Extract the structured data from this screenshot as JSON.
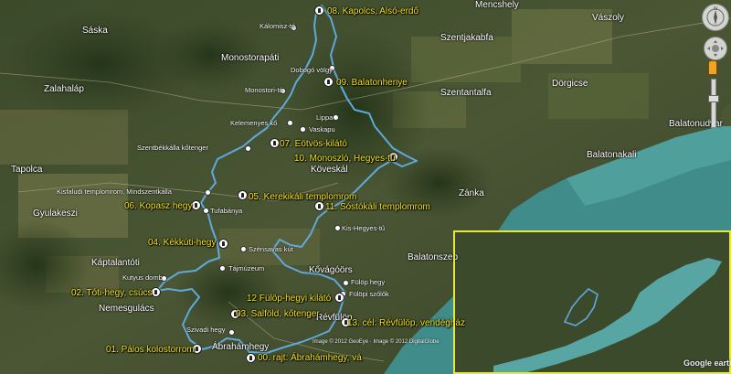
{
  "towns": [
    {
      "id": "saska",
      "text": "Sáska"
    },
    {
      "id": "zalahalap",
      "text": "Zalahaláp"
    },
    {
      "id": "monostorapati",
      "text": "Monostorapáti"
    },
    {
      "id": "tapolca",
      "text": "Tapolca"
    },
    {
      "id": "gyulakeszi",
      "text": "Gyulakeszi"
    },
    {
      "id": "kaptalantoti",
      "text": "Káptalantóti"
    },
    {
      "id": "nemesgulacs",
      "text": "Nemesgulács"
    },
    {
      "id": "kovagoors",
      "text": "Kővágóörs"
    },
    {
      "id": "mencshely",
      "text": "Mencshely"
    },
    {
      "id": "vaszoly",
      "text": "Vászoly"
    },
    {
      "id": "szentjakabfa",
      "text": "Szentjakabfa"
    },
    {
      "id": "dorgicse",
      "text": "Dörgicse"
    },
    {
      "id": "szentantalfa",
      "text": "Szentantalfa"
    },
    {
      "id": "balatonudvari",
      "text": "Balatonudvar"
    },
    {
      "id": "balatonakali",
      "text": "Balatonakali"
    },
    {
      "id": "zanka",
      "text": "Zánka"
    },
    {
      "id": "balatonszep",
      "text": "Balatonszep"
    },
    {
      "id": "koveskal",
      "text": "Köveskál"
    },
    {
      "id": "abrahamhegy",
      "text": "Ábrahámhegy"
    },
    {
      "id": "revfulop",
      "text": "Révfülöp"
    }
  ],
  "pois": [
    {
      "id": "kalomisz-to",
      "text": "Kálomisz-tó"
    },
    {
      "id": "dobogo-volgy",
      "text": "Dobogó völgy"
    },
    {
      "id": "monostori-to",
      "text": "Monostori-tó"
    },
    {
      "id": "lippa",
      "text": "Lippa"
    },
    {
      "id": "vaskapu",
      "text": "Vaskapu"
    },
    {
      "id": "kelemenyes-ko",
      "text": "Kelemenyes kő"
    },
    {
      "id": "szentbekkalla-kotenger",
      "text": "Szentbékkálla kőtenger"
    },
    {
      "id": "kisfaludi-templomrom",
      "text": "Kisfaludi templomrom, Mindszentkálla"
    },
    {
      "id": "tufabanya",
      "text": "Tufabánya"
    },
    {
      "id": "szensavas-kut",
      "text": "Szénsavas kút"
    },
    {
      "id": "tajmuzeum",
      "text": "Tájmúzeum"
    },
    {
      "id": "kutyus-domb",
      "text": "Kutyus domb"
    },
    {
      "id": "kis-hegyes-tu",
      "text": "Kis-Hegyes-tű"
    },
    {
      "id": "fulop-hegy",
      "text": "Fülöp hegy"
    },
    {
      "id": "fulopi-szolok",
      "text": "Fülöpi szőlők"
    },
    {
      "id": "szivadi-hegy",
      "text": "Szivadi hegy"
    }
  ],
  "stages": [
    {
      "id": "s00",
      "text": "00. rajt: Ábrahámhegy, vá"
    },
    {
      "id": "s01",
      "text": "01. Pálos kolostorrom"
    },
    {
      "id": "s02",
      "text": "02. Tóti-hegy, csúcs"
    },
    {
      "id": "s03",
      "text": "03. Salföld, kőtenger"
    },
    {
      "id": "s04",
      "text": "04. Kékkúti-hegy"
    },
    {
      "id": "s05",
      "text": "05. Kerekikáli templomrom"
    },
    {
      "id": "s06",
      "text": "06. Kopasz hegy"
    },
    {
      "id": "s07",
      "text": "07. Eötvös-kilátó"
    },
    {
      "id": "s08",
      "text": "08. Kapolcs, Alsó-erdő"
    },
    {
      "id": "s09",
      "text": "09. Balatonhenye"
    },
    {
      "id": "s10",
      "text": "10. Monoszló, Hegyes-tű"
    },
    {
      "id": "s11",
      "text": "11. Sóstókáli templomrom"
    },
    {
      "id": "s12",
      "text": "12 Fülöp-hegyi kilátó"
    },
    {
      "id": "s13",
      "text": "13. cél: Révfülöp, vendégház"
    }
  ],
  "credit": "Image © 2012 GeoEye · Image © 2012 DigitalGlobe",
  "google_logo": "Google earth",
  "colors": {
    "track": "#5fa9dc",
    "label": "#f5e41e",
    "lake": "#3f8c8a",
    "inset_border": "#e6e833"
  },
  "icons": {
    "marker": "hiker-pin-icon",
    "poi": "dot-icon",
    "nav": "compass-icon",
    "look": "look-joystick-icon",
    "zoom": "zoom-slider-icon",
    "street": "pegman-icon"
  }
}
